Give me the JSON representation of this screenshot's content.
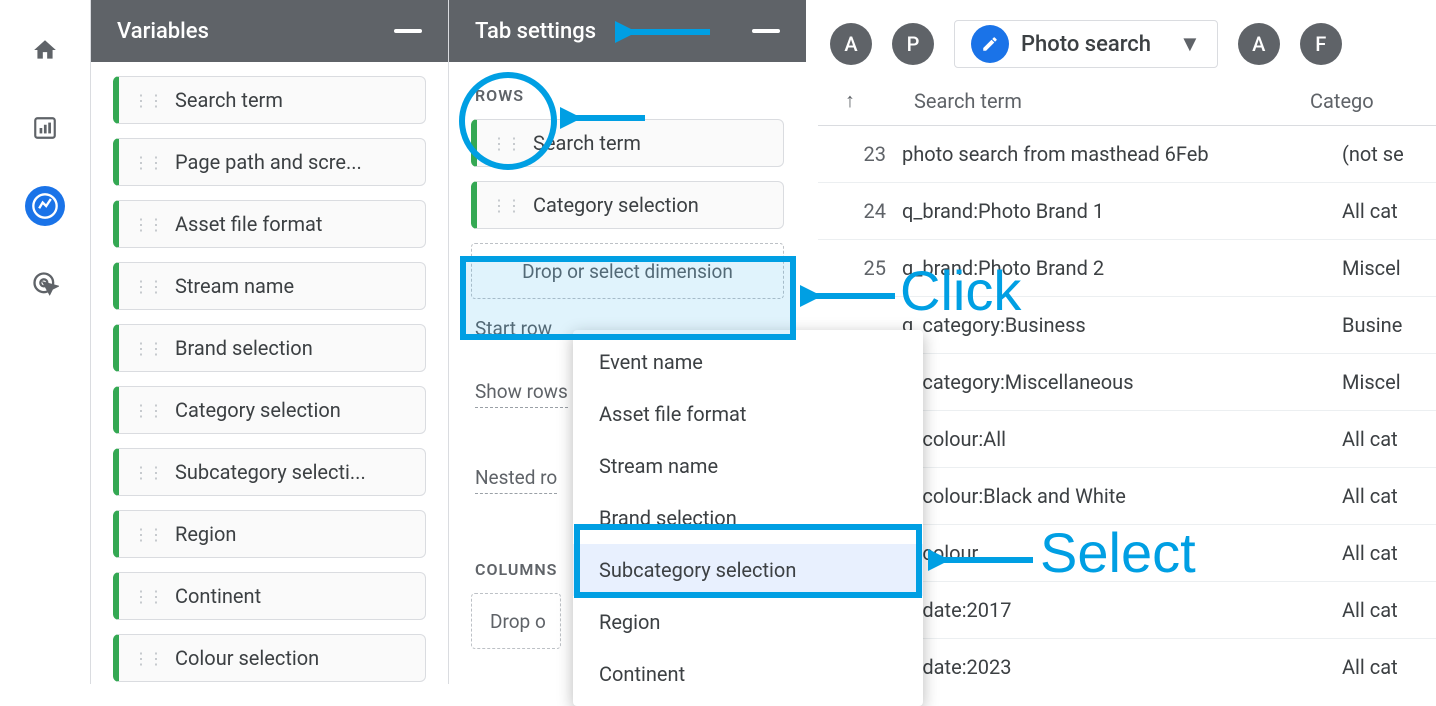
{
  "rail": {
    "items": [
      "home",
      "chart",
      "explore",
      "target"
    ]
  },
  "variablesPanel": {
    "title": "Variables",
    "items": [
      "Search term",
      "Page path and scre...",
      "Asset file format",
      "Stream name",
      "Brand selection",
      "Category selection",
      "Subcategory selecti...",
      "Region",
      "Continent",
      "Colour selection"
    ]
  },
  "tabSettingsPanel": {
    "title": "Tab settings",
    "sections": {
      "rows": "ROWS",
      "columns": "COLUMNS"
    },
    "rows": [
      "Search term",
      "Category selection"
    ],
    "dropzoneRows": "Drop or select dimension",
    "startRowLabel": "Start row",
    "showRowsLabel": "Show rows",
    "nestedRowsLabel": "Nested ro",
    "dropzoneCols": "Drop o"
  },
  "dimensionMenu": {
    "items": [
      "Event name",
      "Asset file format",
      "Stream name",
      "Brand selection",
      "Subcategory selection",
      "Region",
      "Continent"
    ],
    "highlightIndex": 4
  },
  "preview": {
    "pills": [
      "A",
      "P"
    ],
    "activeTab": "Photo search",
    "pillsRight": [
      "A",
      "F"
    ],
    "headers": [
      "Search term",
      "Catego"
    ],
    "rows": [
      {
        "idx": "23",
        "term": "photo search from masthead 6Feb",
        "cat": "(not se"
      },
      {
        "idx": "24",
        "term": "q_brand:Photo Brand 1",
        "cat": "All cat"
      },
      {
        "idx": "25",
        "term": "q_brand:Photo Brand 2",
        "cat": "Miscel"
      },
      {
        "idx": "",
        "term": "q_category:Business",
        "cat": "Busine"
      },
      {
        "idx": "",
        "term": "q_category:Miscellaneous",
        "cat": "Miscel"
      },
      {
        "idx": "",
        "term": "q_colour:All",
        "cat": "All cat"
      },
      {
        "idx": "",
        "term": "q_colour:Black and White",
        "cat": "All cat"
      },
      {
        "idx": "",
        "term": "q_colour",
        "cat": "All cat"
      },
      {
        "idx": "",
        "term": "q_date:2017",
        "cat": "All cat"
      },
      {
        "idx": "",
        "term": "q_date:2023",
        "cat": "All cat"
      }
    ]
  },
  "annotations": {
    "click": "Click",
    "select": "Select"
  }
}
